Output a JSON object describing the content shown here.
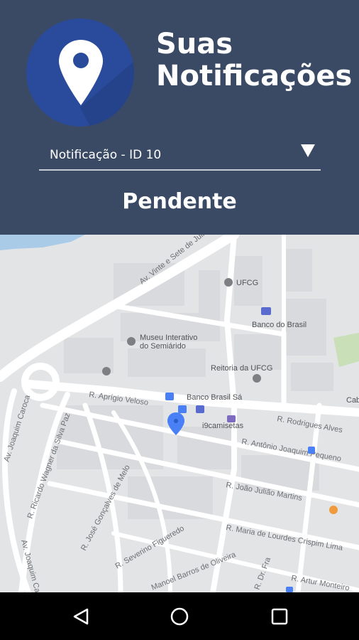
{
  "header": {
    "title_line1": "Suas",
    "title_line2": "Notificações",
    "logo_icon": "map-pin-icon"
  },
  "dropdown": {
    "selected": "Notificação - ID 10"
  },
  "status": "Pendente",
  "map": {
    "streets": [
      "Av. Vinte e Sete de Julho",
      "R. Aprígio Veloso",
      "R. Rodrigues Alves",
      "R. Antônio Joaquim Pequeno",
      "R. João Julião Martins",
      "R. Maria de Lourdes Crispim Lima",
      "R. Artur Monteiro",
      "R. Severino Figueredo",
      "Manoel Barros de Oliveira",
      "R. José Gonçalves de Melo",
      "R. Ricardo Wagner da Silva Paz",
      "Av. Joaquim Caroca",
      "Av. Joaquim Caroca",
      "R. Dr. Fra"
    ],
    "places": [
      "UFCG",
      "Banco do Brasil",
      "Museu Interativo",
      "do Semiárido",
      "Reitoria da UFCG",
      "Banco Brasil Sá",
      "i9camisetas",
      "Cab"
    ]
  },
  "navbar": {
    "back_icon": "back-triangle-icon",
    "home_icon": "home-circle-icon",
    "recents_icon": "recents-square-icon"
  },
  "colors": {
    "header_bg": "#3b4a64",
    "logo_bg": "#2a4a9c",
    "map_bg": "#e3e4e6",
    "marker": "#4a80f5"
  }
}
